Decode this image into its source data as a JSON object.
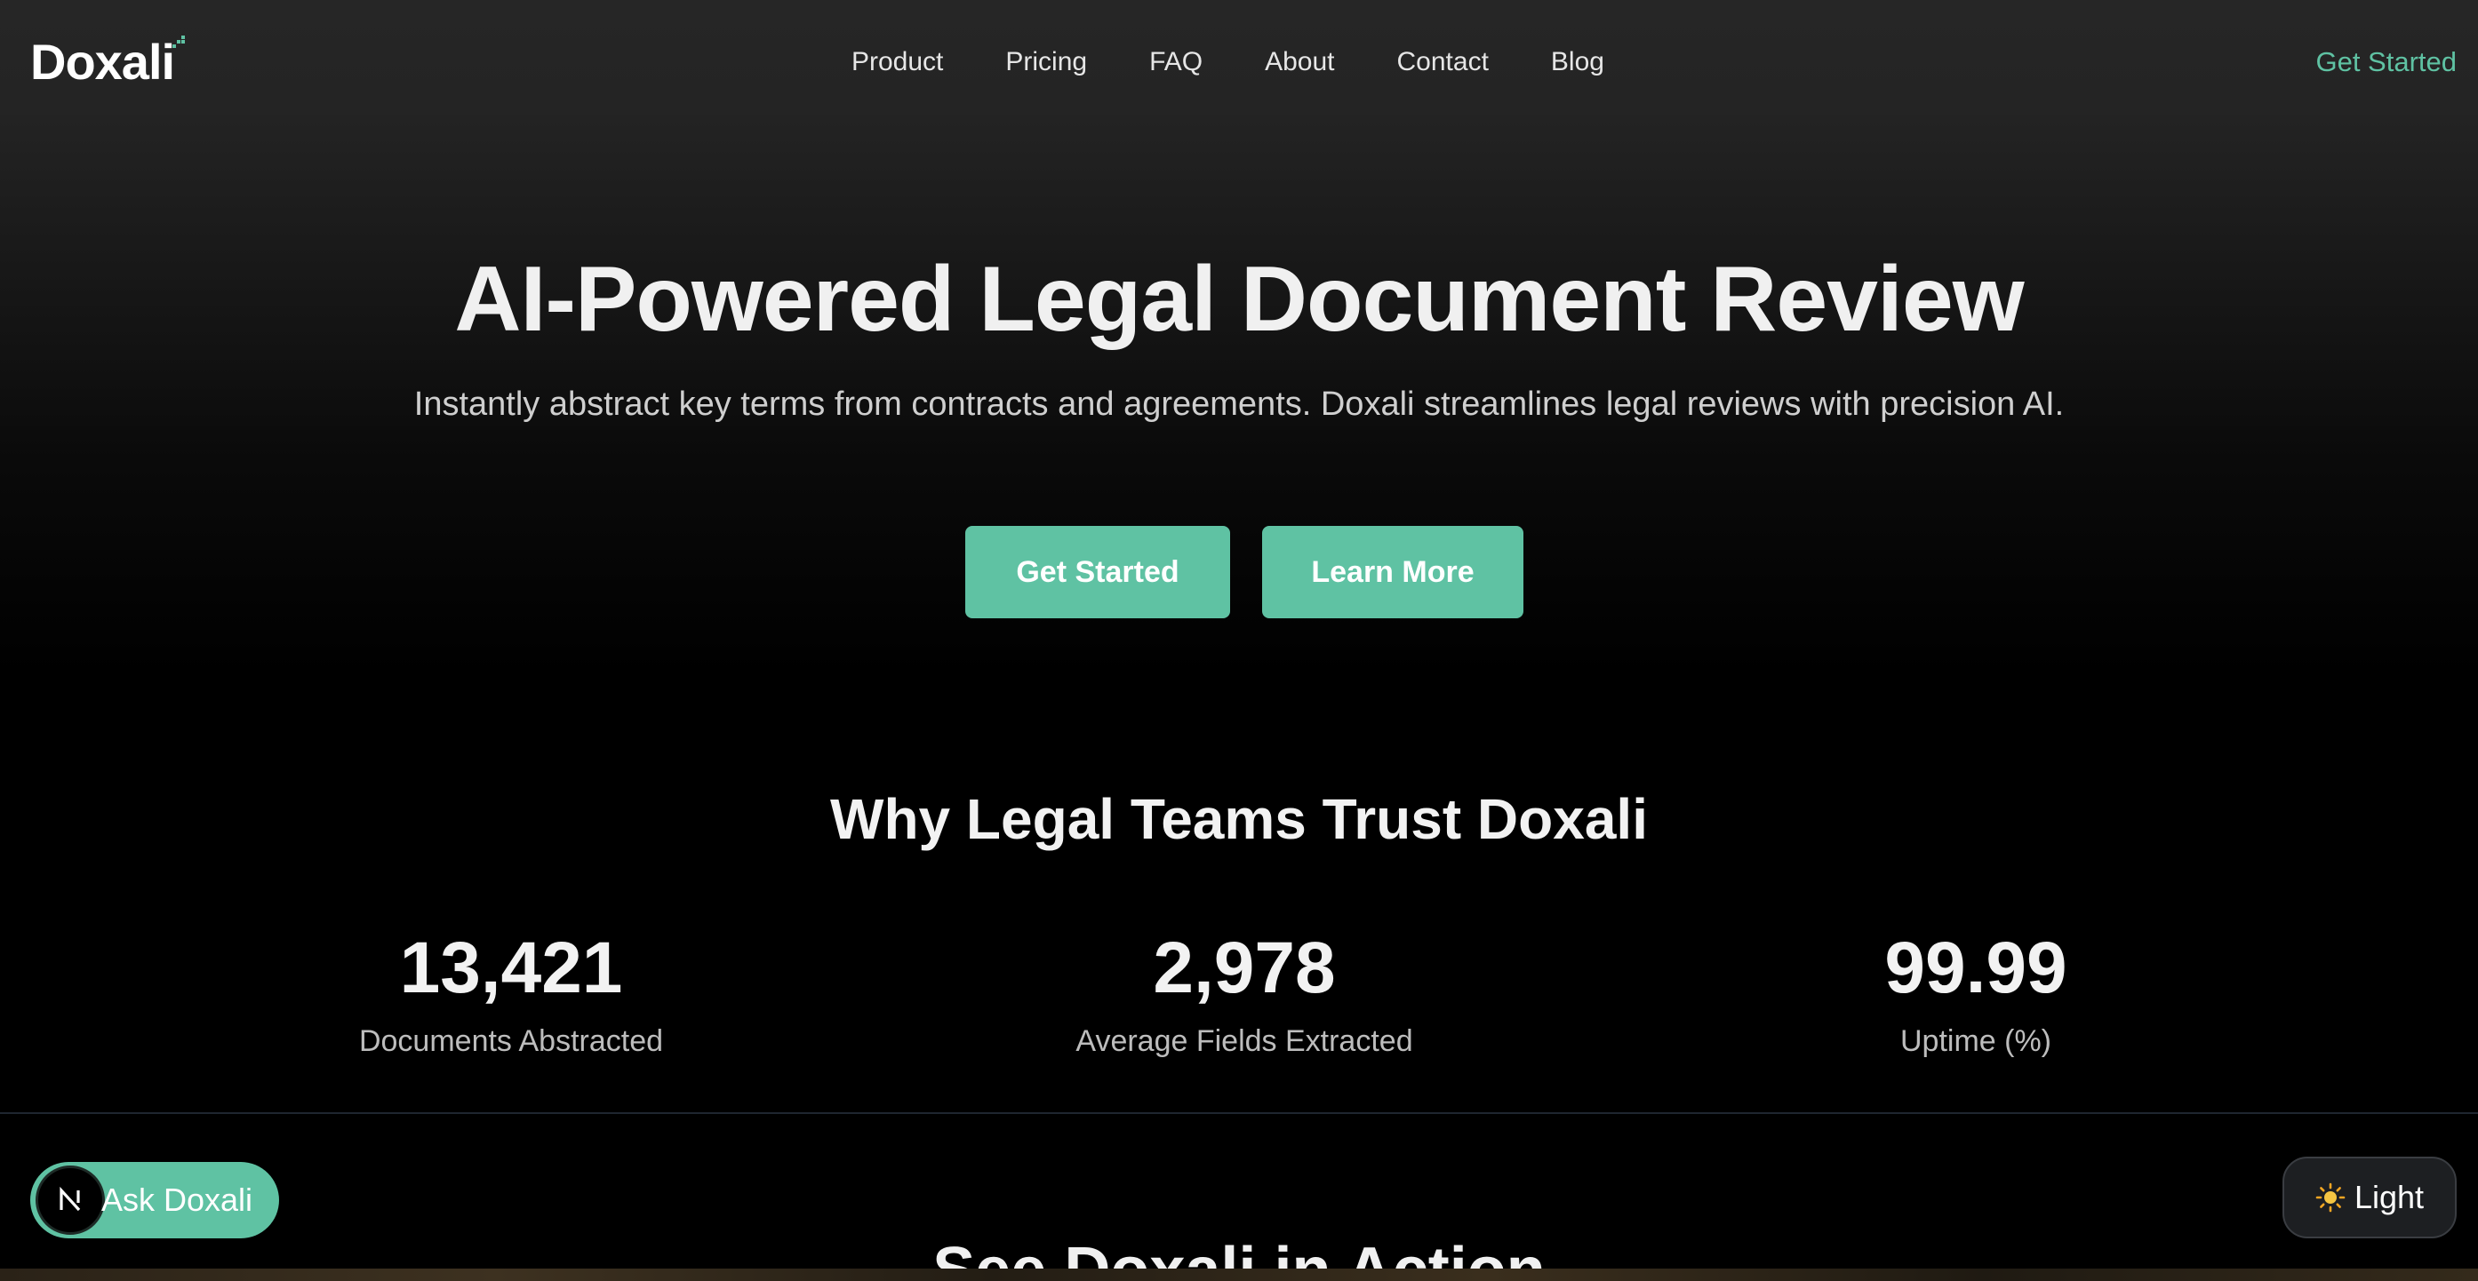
{
  "header": {
    "logo_text": "Doxali",
    "nav": [
      "Product",
      "Pricing",
      "FAQ",
      "About",
      "Contact",
      "Blog"
    ],
    "cta": "Get Started"
  },
  "hero": {
    "title": "AI-Powered Legal Document Review",
    "subtitle": "Instantly abstract key terms from contracts and agreements. Doxali streamlines legal reviews with precision AI.",
    "primary_button": "Get Started",
    "secondary_button": "Learn More"
  },
  "why": {
    "title": "Why Legal Teams Trust Doxali",
    "stats": [
      {
        "value": "13,421",
        "label": "Documents Abstracted"
      },
      {
        "value": "2,978",
        "label": "Average Fields Extracted"
      },
      {
        "value": "99.99",
        "label": "Uptime (%)"
      }
    ]
  },
  "action": {
    "title": "See Doxali in Action"
  },
  "floating": {
    "ask_avatar_letter": "N",
    "ask_label": "Ask Doxali",
    "theme_icon": "sun-icon",
    "theme_label": "Light"
  },
  "colors": {
    "accent": "#5fc2a3",
    "background": "#000000",
    "header_bg": "#262626"
  }
}
